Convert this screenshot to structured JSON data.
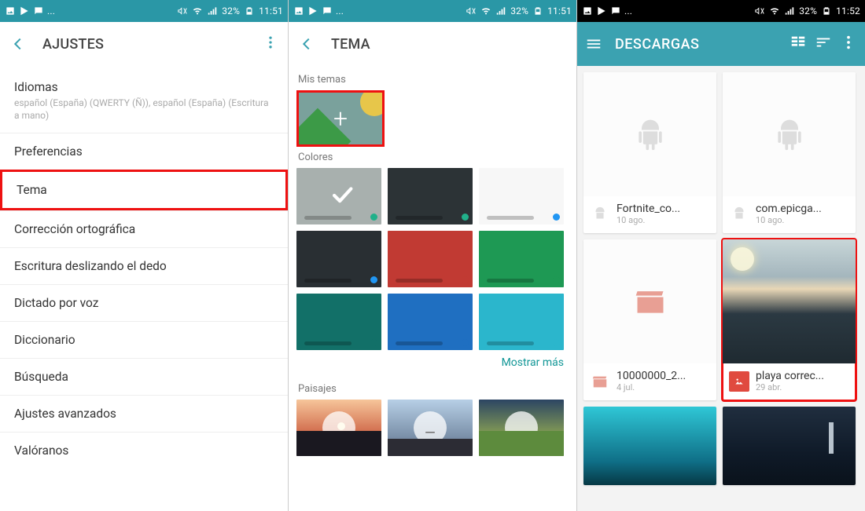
{
  "status": {
    "battery": "32%",
    "time1": "11:51",
    "time2": "11:52"
  },
  "panel1": {
    "title": "AJUSTES",
    "items": [
      {
        "label": "Idiomas",
        "sub": "español (España) (QWERTY (Ñ)), español (España) (Escritura a mano)"
      },
      {
        "label": "Preferencias"
      },
      {
        "label": "Tema"
      },
      {
        "label": "Corrección ortográfica"
      },
      {
        "label": "Escritura deslizando el dedo"
      },
      {
        "label": "Dictado por voz"
      },
      {
        "label": "Diccionario"
      },
      {
        "label": "Búsqueda"
      },
      {
        "label": "Ajustes avanzados"
      },
      {
        "label": "Valóranos"
      }
    ]
  },
  "panel2": {
    "title": "TEMA",
    "section_mis_temas": "Mis temas",
    "section_colores": "Colores",
    "more": "Mostrar más",
    "section_paisajes": "Paisajes",
    "colors": [
      {
        "bg": "#a8b0ae",
        "dot": "#21b08a",
        "checked": true
      },
      {
        "bg": "#2c3336",
        "dot": "#21b08a"
      },
      {
        "bg": "#f7f7f7",
        "dot": "#2196f3"
      },
      {
        "bg": "#292f33",
        "dot": "#2196f3"
      },
      {
        "bg": "#c13a33",
        "dot": "#c13a33"
      },
      {
        "bg": "#1e9954",
        "dot": "#1e9954"
      },
      {
        "bg": "#127068",
        "dot": "#127068"
      },
      {
        "bg": "#1f6fc1",
        "dot": "#1f6fc1"
      },
      {
        "bg": "#2bb6cc",
        "dot": "#2bb6cc"
      }
    ]
  },
  "panel3": {
    "title": "DESCARGAS",
    "cards": [
      {
        "name": "Fortnite_co...",
        "date": "10 ago.",
        "type": "apk"
      },
      {
        "name": "com.epicga...",
        "date": "10 ago.",
        "type": "apk"
      },
      {
        "name": "10000000_2...",
        "date": "4 jul.",
        "type": "video"
      },
      {
        "name": "playa correc...",
        "date": "29 abr.",
        "type": "image"
      }
    ]
  }
}
